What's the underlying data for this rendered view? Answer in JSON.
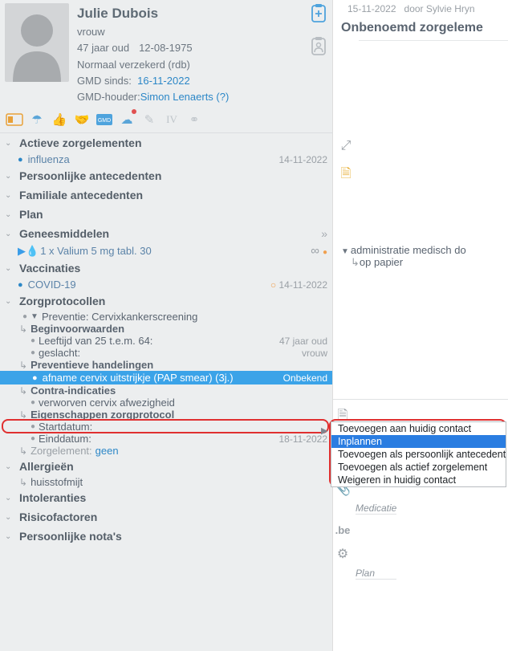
{
  "patient": {
    "name": "Julie Dubois",
    "gender": "vrouw",
    "age_line_age": "47 jaar oud",
    "dob": "12-08-1975",
    "insurance": "Normaal verzekerd (rdb)",
    "gmd_sinds_label": "GMD sinds:",
    "gmd_sinds_value": "16-11-2022",
    "gmd_holder_label": "GMD-houder:",
    "gmd_holder_value": "Simon Lenaerts (?)"
  },
  "sections": {
    "actieve": {
      "title": "Actieve zorgelementen",
      "item": "influenza",
      "date": "14-11-2022"
    },
    "persoonlijke": {
      "title": "Persoonlijke antecedenten"
    },
    "familiale": {
      "title": "Familiale antecedenten"
    },
    "plan": {
      "title": "Plan"
    },
    "geneesmiddelen": {
      "title": "Geneesmiddelen",
      "item": "1 x Valium 5 mg tabl. 30"
    },
    "vaccinaties": {
      "title": "Vaccinaties",
      "item": "COVID-19",
      "date": "14-11-2022"
    },
    "zorgprotocollen": {
      "title": "Zorgprotocollen",
      "preventie": "Preventie: Cervixkankerscreening",
      "begin": "Beginvoorwaarden",
      "leeftijd_label": "Leeftijd van 25 t.e.m. 64:",
      "leeftijd_value": "47 jaar oud",
      "geslacht_label": "geslacht:",
      "geslacht_value": "vrouw",
      "prev_hand": "Preventieve handelingen",
      "pap_label": "afname cervix uitstrijkje (PAP smear)  (3j.)",
      "pap_status": "Onbekend",
      "contra": "Contra-indicaties",
      "contra_item": "verworven cervix afwezigheid",
      "eigen": "Eigenschappen zorgprotocol",
      "startdatum": "Startdatum:",
      "einddatum": "Einddatum:",
      "eind_value": "18-11-2022",
      "zorg_label": "Zorgelement:",
      "zorg_value": "geen"
    },
    "allergieen": {
      "title": "Allergieën",
      "item": "huisstofmijt"
    },
    "intoleranties": {
      "title": "Intoleranties"
    },
    "risicofactoren": {
      "title": "Risicofactoren"
    },
    "notas": {
      "title": "Persoonlijke nota's"
    }
  },
  "context_menu": {
    "items": [
      "Toevoegen aan huidig contact",
      "Inplannen",
      "Toevoegen als persoonlijk antecedent",
      "Toevoegen als actief zorgelement",
      "Weigeren in huidig contact"
    ],
    "selected_index": 1
  },
  "right": {
    "note_date": "15-11-2022",
    "note_by_label": "door",
    "note_by": "Sylvie Hryn",
    "note_title": "Onbenoemd zorgeleme",
    "admin_line": "administratie medisch do",
    "admin_sub": "op papier",
    "labels": {
      "medicatie": "Medicatie",
      "plan": "Plan"
    }
  }
}
